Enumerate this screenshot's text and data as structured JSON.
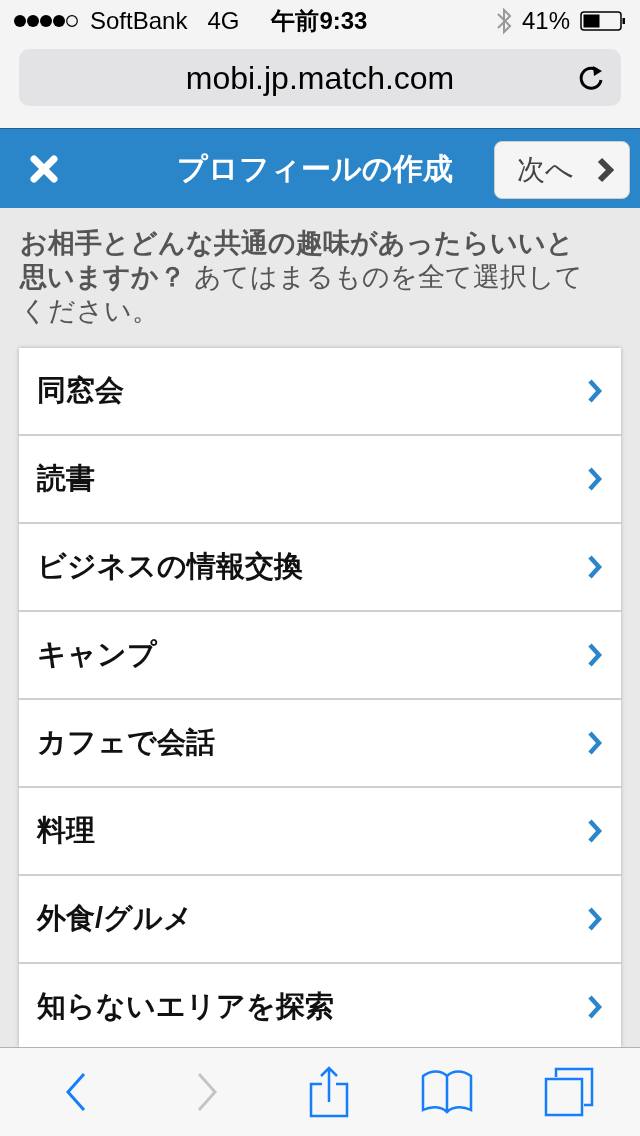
{
  "status_bar": {
    "carrier": "SoftBank",
    "network": "4G",
    "time": "午前9:33",
    "battery": "41%"
  },
  "address_bar": {
    "url": "mobi.jp.match.com"
  },
  "header": {
    "title": "プロフィールの作成",
    "next_button": "次へ"
  },
  "question": "**お相手とどんな共通の趣味があったらいいと思いますか？** あてはまるものを全て選択してください。",
  "options": [
    {
      "label": "同窓会"
    },
    {
      "label": "読書"
    },
    {
      "label": "ビジネスの情報交換"
    },
    {
      "label": "キャンプ"
    },
    {
      "label": "カフェで会話"
    },
    {
      "label": "料理"
    },
    {
      "label": "外食/グルメ"
    },
    {
      "label": "知らないエリアを探索"
    }
  ],
  "toolbar": {
    "back_disabled": false,
    "forward_disabled": true
  }
}
